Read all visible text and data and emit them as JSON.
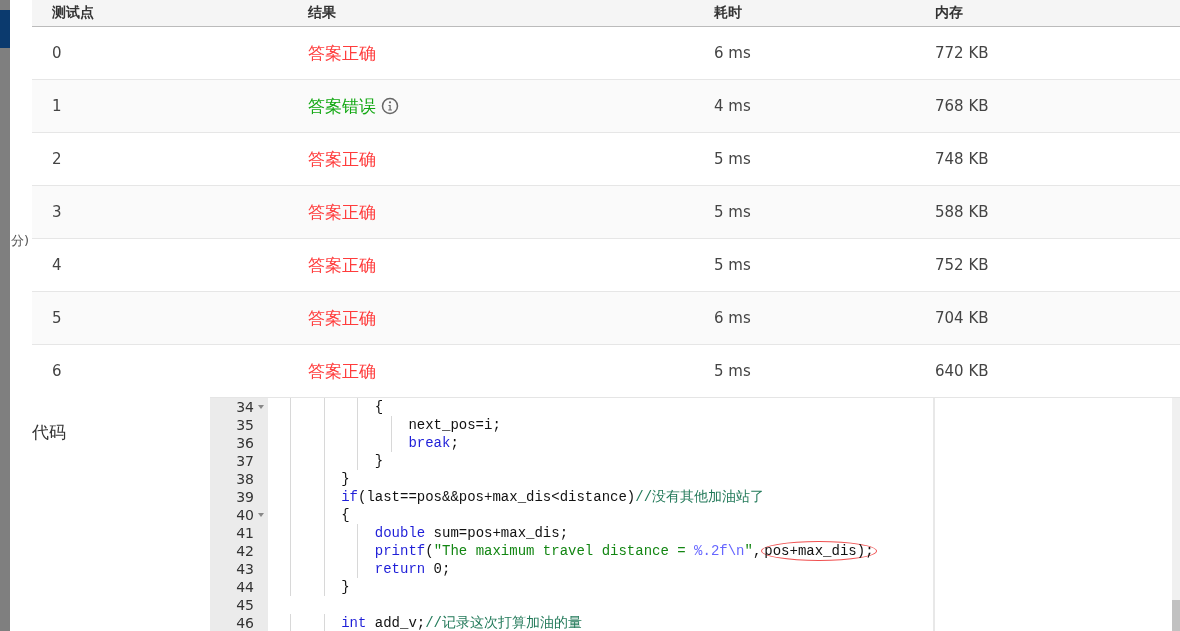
{
  "side_text": "分)",
  "table": {
    "columns": [
      "测试点",
      "结果",
      "耗时",
      "内存"
    ],
    "rows": [
      {
        "point": "0",
        "result": "答案正确",
        "correct": true,
        "time": "6 ms",
        "memory": "772 KB"
      },
      {
        "point": "1",
        "result": "答案错误",
        "correct": false,
        "time": "4 ms",
        "memory": "768 KB"
      },
      {
        "point": "2",
        "result": "答案正确",
        "correct": true,
        "time": "5 ms",
        "memory": "748 KB"
      },
      {
        "point": "3",
        "result": "答案正确",
        "correct": true,
        "time": "5 ms",
        "memory": "588 KB"
      },
      {
        "point": "4",
        "result": "答案正确",
        "correct": true,
        "time": "5 ms",
        "memory": "752 KB"
      },
      {
        "point": "5",
        "result": "答案正确",
        "correct": true,
        "time": "6 ms",
        "memory": "704 KB"
      },
      {
        "point": "6",
        "result": "答案正确",
        "correct": true,
        "time": "5 ms",
        "memory": "640 KB"
      }
    ]
  },
  "code_label": "代码",
  "code": [
    {
      "n": "34",
      "fold": true,
      "tokens": [
        {
          "kind": "txt",
          "t": "            {"
        }
      ]
    },
    {
      "n": "35",
      "fold": false,
      "tokens": [
        {
          "kind": "txt",
          "t": "                next_pos=i;"
        }
      ]
    },
    {
      "n": "36",
      "fold": false,
      "tokens": [
        {
          "kind": "kw",
          "t": "                break"
        },
        {
          "kind": "txt",
          "t": ";"
        }
      ]
    },
    {
      "n": "37",
      "fold": false,
      "tokens": [
        {
          "kind": "txt",
          "t": "            }"
        }
      ]
    },
    {
      "n": "38",
      "fold": false,
      "tokens": [
        {
          "kind": "txt",
          "t": "        }"
        }
      ]
    },
    {
      "n": "39",
      "fold": false,
      "tokens": [
        {
          "kind": "kw",
          "t": "        if"
        },
        {
          "kind": "txt",
          "t": "(last==pos&&pos+max_dis<distance)"
        },
        {
          "kind": "cmt",
          "t": "//没有其他加油站了"
        }
      ]
    },
    {
      "n": "40",
      "fold": true,
      "tokens": [
        {
          "kind": "txt",
          "t": "        {"
        }
      ]
    },
    {
      "n": "41",
      "fold": false,
      "tokens": [
        {
          "kind": "kw",
          "t": "            double"
        },
        {
          "kind": "txt",
          "t": " sum=pos+max_dis;"
        }
      ]
    },
    {
      "n": "42",
      "fold": false,
      "tokens": [
        {
          "kind": "kw",
          "t": "            printf"
        },
        {
          "kind": "txt",
          "t": "("
        },
        {
          "kind": "str",
          "t": "\"The maximum travel distance = "
        },
        {
          "kind": "esc",
          "t": "%.2f\\n"
        },
        {
          "kind": "str",
          "t": "\""
        },
        {
          "kind": "txt",
          "t": ","
        },
        {
          "kind": "circled",
          "t": "pos+max_dis);"
        }
      ]
    },
    {
      "n": "43",
      "fold": false,
      "tokens": [
        {
          "kind": "kw",
          "t": "            return"
        },
        {
          "kind": "num",
          "t": " 0"
        },
        {
          "kind": "txt",
          "t": ";"
        }
      ]
    },
    {
      "n": "44",
      "fold": false,
      "tokens": [
        {
          "kind": "txt",
          "t": "        }"
        }
      ]
    },
    {
      "n": "45",
      "fold": false
    },
    {
      "n": "46",
      "fold": false,
      "tokens": [
        {
          "kind": "kw",
          "t": "        int"
        },
        {
          "kind": "txt",
          "t": " add_v;"
        },
        {
          "kind": "cmt",
          "t": "//记录这次打算加油的量"
        }
      ]
    }
  ]
}
